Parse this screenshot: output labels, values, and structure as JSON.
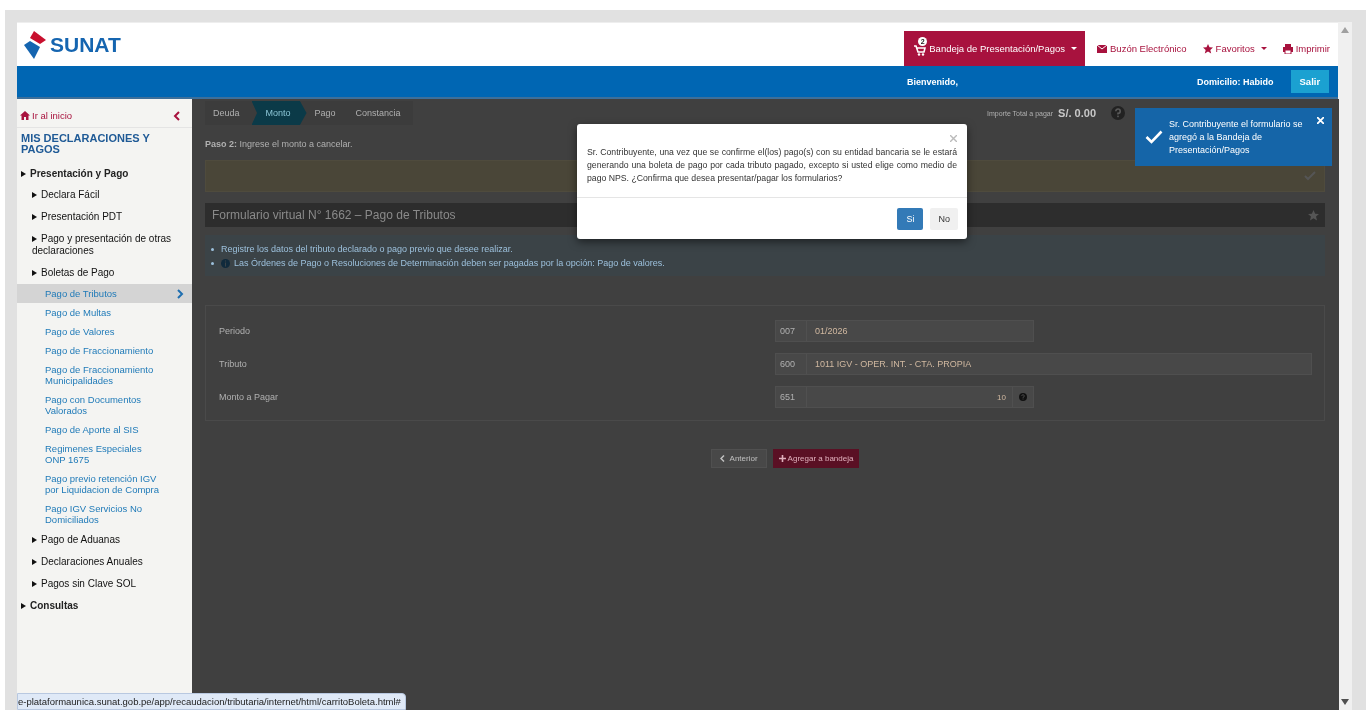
{
  "header": {
    "logo": "SUNAT",
    "nav": [
      {
        "kind": "tray",
        "label": "Bandeja de Presentación/Pagos",
        "badge": "2",
        "selected": true
      },
      {
        "kind": "mail",
        "label": "Buzón Electrónico",
        "selected": false
      },
      {
        "kind": "favorites",
        "label": "Favoritos",
        "selected": false
      },
      {
        "kind": "print",
        "label": "Imprimir",
        "selected": false
      }
    ]
  },
  "user_bar": {
    "welcome": "Bienvenido,",
    "domicile": "Domicilio: Habido",
    "logout": "Salir"
  },
  "sidebar": {
    "home": "Ir al inicio",
    "title": "MIS DECLARACIONES Y PAGOS",
    "tree": [
      {
        "label": "Presentación y Pago",
        "selected": false,
        "children": [
          {
            "label": "Declara Fácil",
            "selected": false
          },
          {
            "label": "Presentación PDT",
            "selected": false
          },
          {
            "label": "Pago y presentación de otras declaraciones",
            "selected": false
          },
          {
            "label": "Boletas de Pago",
            "selected": false,
            "children": [
              {
                "label": "Pago de Tributos",
                "selected": true
              },
              {
                "label": "Pago de Multas",
                "selected": false
              },
              {
                "label": "Pago de Valores",
                "selected": false
              },
              {
                "label": "Pago de Fraccionamiento",
                "selected": false
              },
              {
                "label": "Pago de Fraccionamiento\nMunicipalidades",
                "selected": false
              },
              {
                "label": "Pago con Documentos\nValorados",
                "selected": false
              },
              {
                "label": "Pago de Aporte al SIS",
                "selected": false
              },
              {
                "label": "Regimenes Especiales\nONP 1675",
                "selected": false
              },
              {
                "label": "Pago previo retención IGV\npor Liquidacion de Compra",
                "selected": false
              },
              {
                "label": "Pago IGV Servicios No\nDomiciliados",
                "selected": false
              }
            ]
          },
          {
            "label": "Pago de Aduanas",
            "selected": false
          },
          {
            "label": "Declaraciones Anuales",
            "selected": false
          },
          {
            "label": "Pagos sin Clave SOL",
            "selected": false
          }
        ]
      },
      {
        "label": "Consultas",
        "selected": false
      }
    ]
  },
  "steps": [
    {
      "label": "Deuda",
      "selected": false
    },
    {
      "label": "Monto",
      "selected": true
    },
    {
      "label": "Pago",
      "selected": false
    },
    {
      "label": "Constancia",
      "selected": false
    }
  ],
  "total": {
    "label": "Importe Total a pagar",
    "amount": "S/. 0.00"
  },
  "instruction": "**Paso 2:** Ingrese el monto a cancelar.",
  "form_title": "Formulario virtual N° 1662 – Pago de Tributos",
  "notes": [
    {
      "kind": "bullet",
      "text": "Registre los datos del tributo declarado o pago previo que desee realizar."
    },
    {
      "kind": "info",
      "text": "Las Órdenes de Pago o Resoluciones de Determinación deben ser pagadas por la opción: Pago de valores."
    }
  ],
  "fields": [
    {
      "kind": "short",
      "label": "Periodo",
      "code": "007",
      "value": "01/2026"
    },
    {
      "kind": "wide",
      "label": "Tributo",
      "code": "600",
      "value": "1011 IGV - OPER. INT. - CTA. PROPIA"
    },
    {
      "kind": "amount",
      "label": "Monto a Pagar",
      "code": "651",
      "value": "10"
    }
  ],
  "actions": {
    "back": "Anterior",
    "add": "Agregar a bandeja"
  },
  "dialog": {
    "message": "Sr. Contribuyente, una vez que se confirme el(los) pago(s) con su entidad bancaria se le estará generando una boleta de pago por cada tributo pagado, excepto si usted elige como medio de pago NPS. ¿Confirma que desea presentar/pagar los formularios?",
    "buttons": [
      {
        "kind": "primary",
        "label": "Si"
      },
      {
        "kind": "default",
        "label": "No"
      }
    ]
  },
  "toast": {
    "message": "Sr. Contribuyente el formulario se agregó a la Bandeja de Presentación/Pagos"
  },
  "status_url": "e-plataformaunica.sunat.gob.pe/app/recaudacion/tributaria/internet/html/carritoBoleta.html#"
}
